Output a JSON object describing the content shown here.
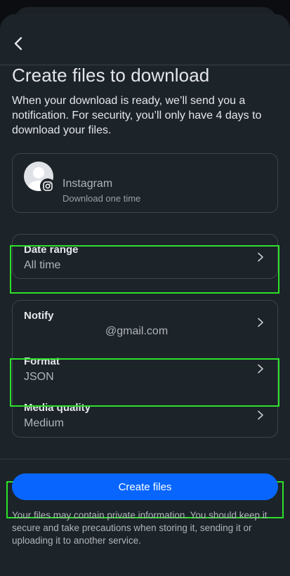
{
  "header": {
    "back_icon": "chevron-left-icon"
  },
  "page": {
    "title": "Create files to download",
    "description": "When your download is ready, we’ll send you a notification. For security, you’ll only have 4 days to download your files."
  },
  "account": {
    "name": "Instagram",
    "subtitle": "Download one time",
    "badge_icon": "instagram-icon"
  },
  "date_range": {
    "title": "Date range",
    "value": "All time"
  },
  "settings": {
    "notify": {
      "title": "Notify",
      "value": "@gmail.com"
    },
    "format": {
      "title": "Format",
      "value": "JSON"
    },
    "media_quality": {
      "title": "Media quality",
      "value": "Medium"
    }
  },
  "actions": {
    "create_label": "Create files"
  },
  "footer": {
    "note": "Your files may contain private information. You should keep it secure and take precautions when storing it, sending it or uploading it to another service."
  },
  "colors": {
    "background": "#1c2329",
    "primary_button": "#0866ff",
    "highlight": "#2ee02a"
  }
}
